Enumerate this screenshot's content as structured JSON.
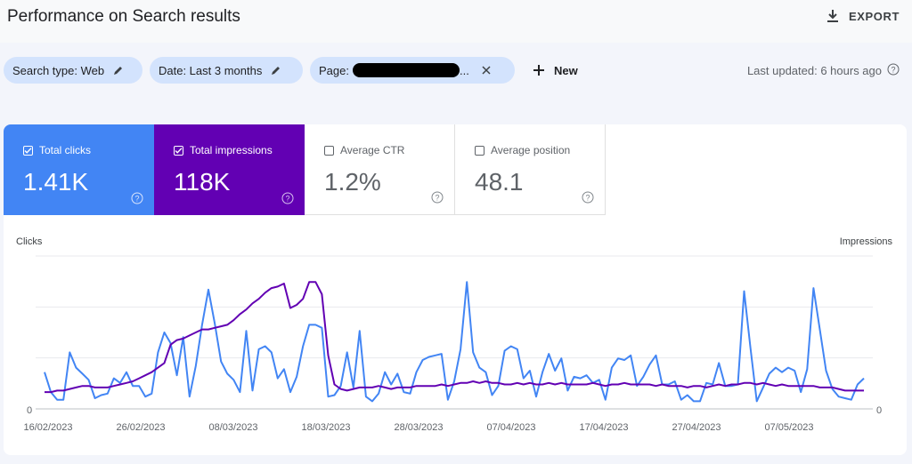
{
  "header": {
    "title": "Performance on Search results",
    "export_label": "EXPORT"
  },
  "filters": {
    "search_type": "Search type: Web",
    "date": "Date: Last 3 months",
    "page_prefix": "Page: ",
    "page_suffix": "...",
    "new_label": "New",
    "last_updated": "Last updated: 6 hours ago"
  },
  "metrics": [
    {
      "label": "Total clicks",
      "value": "1.41K",
      "selected": true
    },
    {
      "label": "Total impressions",
      "value": "118K",
      "selected": true
    },
    {
      "label": "Average CTR",
      "value": "1.2%",
      "selected": false
    },
    {
      "label": "Average position",
      "value": "48.1",
      "selected": false
    }
  ],
  "colors": {
    "clicks": "#4285f4",
    "impressions": "#6200b3",
    "chip": "#d3e3fd"
  },
  "chart_data": {
    "type": "line",
    "left_axis_label": "Clicks",
    "right_axis_label": "Impressions",
    "y_left_zero": "0",
    "y_right_zero": "0",
    "x_tick_labels": [
      "16/02/2023",
      "26/02/2023",
      "08/03/2023",
      "18/03/2023",
      "28/03/2023",
      "07/04/2023",
      "17/04/2023",
      "27/04/2023",
      "07/05/2023"
    ],
    "y_normalized_range": [
      0,
      1
    ],
    "grid": true,
    "series": [
      {
        "name": "Total clicks",
        "color": "#4285f4",
        "values": [
          0.24,
          0.11,
          0.06,
          0.06,
          0.37,
          0.27,
          0.23,
          0.19,
          0.07,
          0.09,
          0.1,
          0.2,
          0.17,
          0.24,
          0.15,
          0.15,
          0.08,
          0.1,
          0.37,
          0.5,
          0.43,
          0.22,
          0.47,
          0.08,
          0.28,
          0.55,
          0.78,
          0.56,
          0.31,
          0.23,
          0.19,
          0.11,
          0.51,
          0.12,
          0.39,
          0.41,
          0.37,
          0.2,
          0.26,
          0.11,
          0.21,
          0.41,
          0.55,
          0.55,
          0.53,
          0.08,
          0.09,
          0.15,
          0.37,
          0.14,
          0.51,
          0.08,
          0.05,
          0.1,
          0.24,
          0.16,
          0.23,
          0.11,
          0.1,
          0.24,
          0.32,
          0.34,
          0.35,
          0.36,
          0.06,
          0.18,
          0.39,
          0.83,
          0.37,
          0.27,
          0.24,
          0.09,
          0.15,
          0.38,
          0.41,
          0.39,
          0.2,
          0.25,
          0.08,
          0.24,
          0.36,
          0.25,
          0.33,
          0.12,
          0.21,
          0.2,
          0.22,
          0.17,
          0.19,
          0.06,
          0.27,
          0.33,
          0.32,
          0.35,
          0.15,
          0.21,
          0.29,
          0.35,
          0.16,
          0.16,
          0.18,
          0.06,
          0.09,
          0.05,
          0.05,
          0.17,
          0.16,
          0.3,
          0.15,
          0.15,
          0.16,
          0.77,
          0.4,
          0.05,
          0.14,
          0.23,
          0.27,
          0.24,
          0.27,
          0.25,
          0.11,
          0.26,
          0.79,
          0.52,
          0.25,
          0.13,
          0.08,
          0.07,
          0.06,
          0.16,
          0.2
        ]
      },
      {
        "name": "Total impressions",
        "color": "#6200b3",
        "values": [
          0.11,
          0.11,
          0.12,
          0.12,
          0.13,
          0.14,
          0.15,
          0.15,
          0.14,
          0.14,
          0.14,
          0.15,
          0.16,
          0.17,
          0.18,
          0.2,
          0.22,
          0.24,
          0.27,
          0.3,
          0.42,
          0.45,
          0.46,
          0.48,
          0.5,
          0.52,
          0.52,
          0.53,
          0.54,
          0.55,
          0.58,
          0.62,
          0.65,
          0.69,
          0.72,
          0.76,
          0.79,
          0.8,
          0.82,
          0.66,
          0.68,
          0.72,
          0.83,
          0.83,
          0.75,
          0.35,
          0.16,
          0.13,
          0.12,
          0.13,
          0.14,
          0.14,
          0.14,
          0.15,
          0.14,
          0.13,
          0.14,
          0.14,
          0.14,
          0.15,
          0.15,
          0.15,
          0.15,
          0.16,
          0.15,
          0.16,
          0.17,
          0.17,
          0.18,
          0.17,
          0.18,
          0.17,
          0.17,
          0.16,
          0.16,
          0.17,
          0.16,
          0.17,
          0.16,
          0.16,
          0.17,
          0.16,
          0.17,
          0.16,
          0.16,
          0.16,
          0.16,
          0.17,
          0.16,
          0.15,
          0.16,
          0.16,
          0.17,
          0.16,
          0.16,
          0.16,
          0.16,
          0.15,
          0.16,
          0.15,
          0.15,
          0.15,
          0.14,
          0.15,
          0.15,
          0.14,
          0.15,
          0.16,
          0.15,
          0.16,
          0.16,
          0.17,
          0.17,
          0.16,
          0.17,
          0.16,
          0.15,
          0.16,
          0.15,
          0.15,
          0.15,
          0.15,
          0.15,
          0.14,
          0.14,
          0.14,
          0.13,
          0.12,
          0.12,
          0.12,
          0.12
        ]
      }
    ]
  }
}
